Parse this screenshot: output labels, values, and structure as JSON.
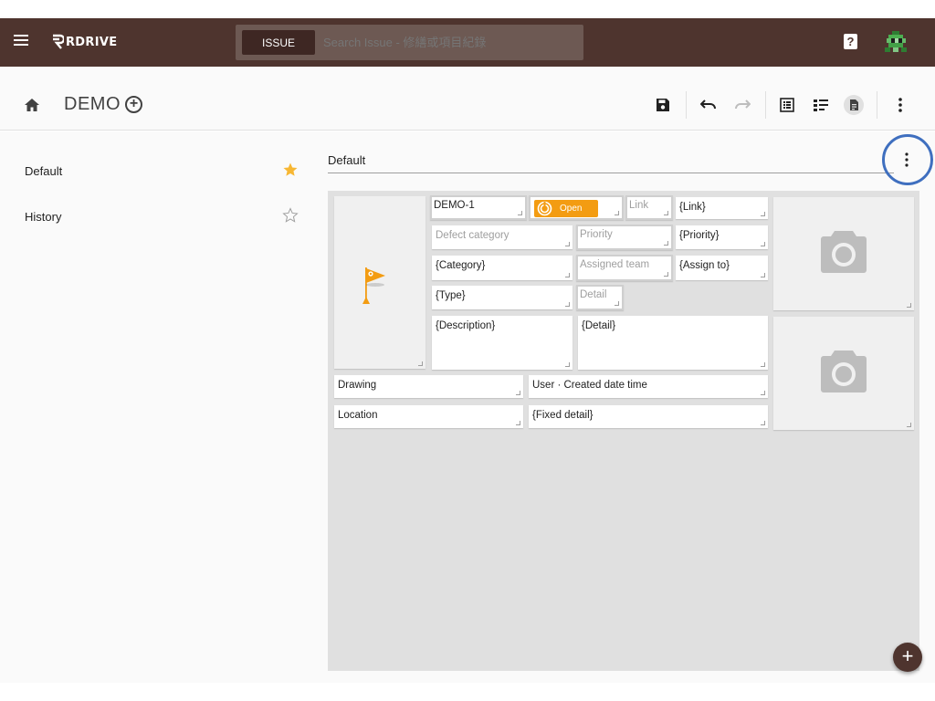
{
  "topbar": {
    "logo_text": "RDRIVE",
    "search_chip": "ISSUE",
    "search_placeholder": "Search Issue - 修繕或項目紀錄",
    "help_icon": "?",
    "background": "#4e342e"
  },
  "header": {
    "project": "DEMO"
  },
  "toolbar": {
    "icons": [
      "save-icon",
      "undo-icon",
      "redo-icon",
      "list-view-icon",
      "detail-view-icon",
      "document-icon",
      "more-vert-icon"
    ]
  },
  "sidebar": {
    "items": [
      {
        "label": "Default",
        "starred": true
      },
      {
        "label": "History",
        "starred": false
      }
    ]
  },
  "main": {
    "layout_name": "Default",
    "fields": {
      "id": "DEMO-1",
      "status": "Open",
      "link_label": "Link",
      "link_value": "{Link}",
      "defect_category": "Defect category",
      "priority_label": "Priority",
      "priority_value": "{Priority}",
      "category_value": "{Category}",
      "assigned_team_label": "Assigned team",
      "assign_to_value": "{Assign to}",
      "type_value": "{Type}",
      "detail_label": "Detail",
      "description_value": "{Description}",
      "detail_value": "{Detail}",
      "drawing": "Drawing",
      "user_created": "User · Created date time",
      "location": "Location",
      "fixed_detail": "{Fixed detail}"
    }
  },
  "colors": {
    "accent": "#f39c12",
    "highlight": "#3f6fbf"
  },
  "fab_label": "+"
}
